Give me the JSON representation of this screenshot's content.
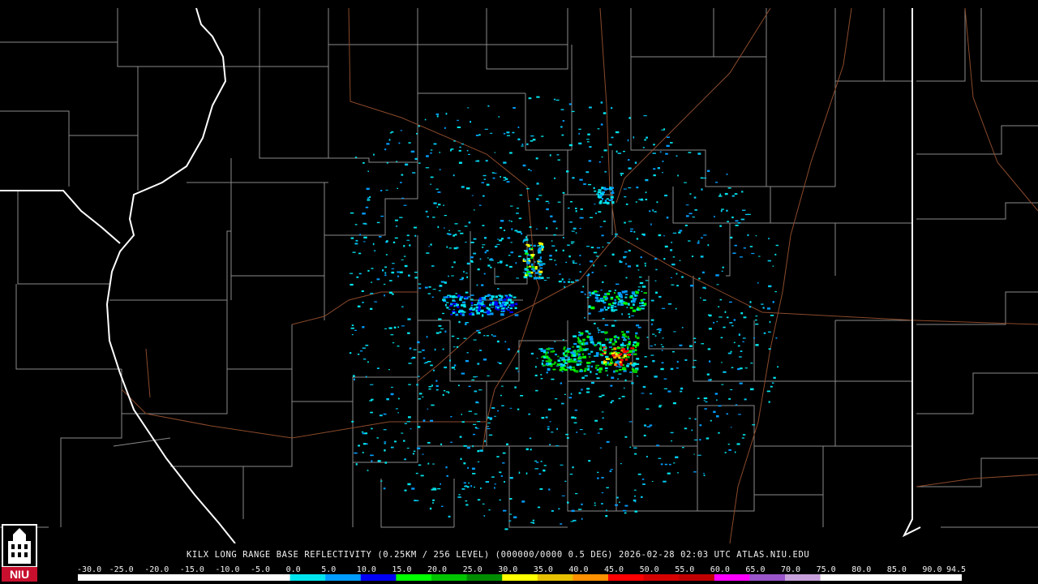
{
  "product": {
    "caption": "KILX LONG RANGE BASE REFLECTIVITY (0.25KM / 256 LEVEL) (000000/0000 0.5 DEG) 2026-02-28 02:03 UTC  ATLAS.NIU.EDU"
  },
  "logo": {
    "text": "NIU",
    "color": "#c8102e"
  },
  "colors": {
    "background": "#000000",
    "county_lines": "#8a8a8a",
    "state_lines": "#ffffff",
    "highways": "#8b4a2b"
  },
  "scale": {
    "labels": [
      "-30.0",
      "-25.0",
      "-20.0",
      "-15.0",
      "-10.0",
      "-5.0",
      "0.0",
      "5.0",
      "10.0",
      "15.0",
      "20.0",
      "25.0",
      "30.0",
      "35.0",
      "40.0",
      "45.0",
      "50.0",
      "55.0",
      "60.0",
      "65.0",
      "70.0",
      "75.0",
      "80.0",
      "85.0",
      "90.0",
      "94.5"
    ],
    "colors": [
      "#ffffff",
      "#ffffff",
      "#ffffff",
      "#ffffff",
      "#ffffff",
      "#ffffff",
      "#00e5ee",
      "#009dff",
      "#0000f6",
      "#00ff00",
      "#00c400",
      "#008c00",
      "#ffff00",
      "#e7c000",
      "#ff9000",
      "#ff0000",
      "#d60000",
      "#c00000",
      "#ff00ff",
      "#9955c9",
      "#c8a0dc",
      "#ffffff",
      "#ffffff",
      "#ffffff",
      "#ffffff",
      "#ffffff"
    ]
  }
}
